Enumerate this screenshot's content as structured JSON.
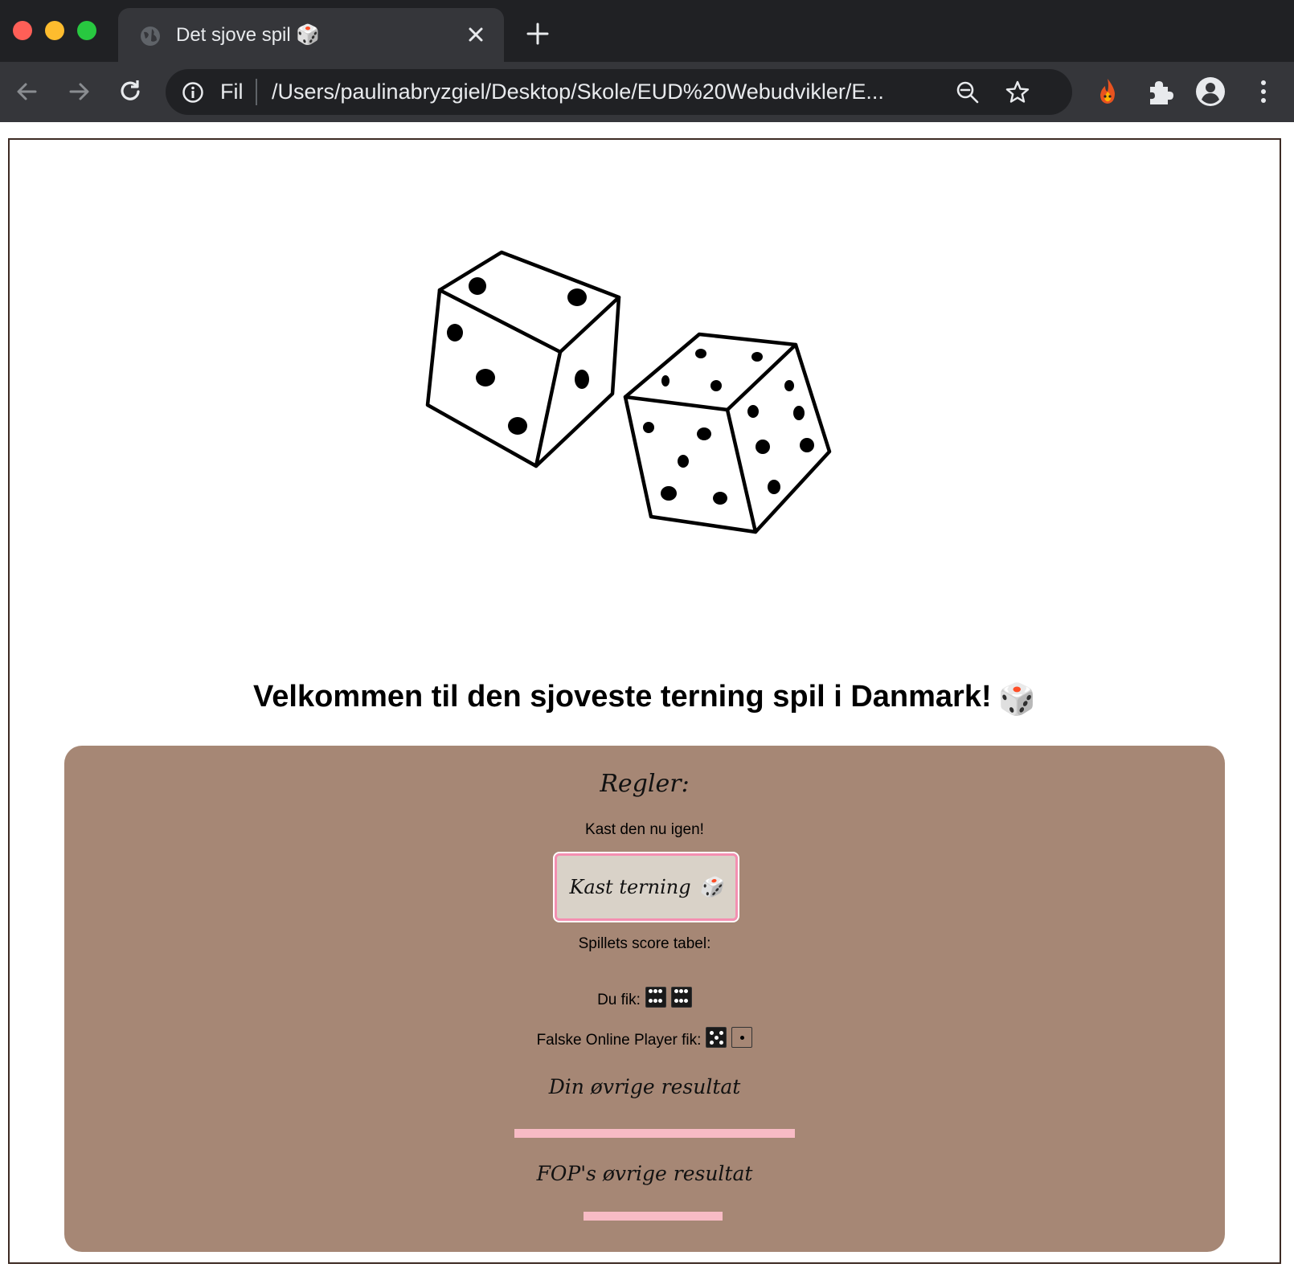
{
  "browser": {
    "tab_title": "Det sjove spil 🎲",
    "scheme_label": "Fil",
    "url": "/Users/paulinabryzgiel/Desktop/Skole/EUD%20Webudvikler/E...",
    "icons": [
      "back-icon",
      "forward-icon",
      "reload-icon",
      "info-icon",
      "zoom-icon",
      "star-icon",
      "extension-fire-icon",
      "puzzle-icon",
      "profile-icon",
      "menu-icon"
    ]
  },
  "page": {
    "welcome": "Velkommen til den sjoveste terning spil i Danmark!",
    "welcome_emoji": "🎲",
    "rules_heading": "Regler:",
    "rules_text": "Kast den nu igen!",
    "roll_button": "Kast terning",
    "roll_button_emoji": "🎲",
    "score_label": "Spillets score tabel:",
    "you_label": "Du fik:",
    "you_dice": [
      6,
      6
    ],
    "fop_label": "Falske Online Player fik:",
    "fop_dice": [
      5,
      1
    ],
    "your_result_heading": "Din øvrige resultat",
    "fop_result_heading": "FOP's øvrige resultat",
    "colors": {
      "panel": "#a68775",
      "button_border": "#f48fb1",
      "result_bar": "#f8bbc5"
    }
  }
}
